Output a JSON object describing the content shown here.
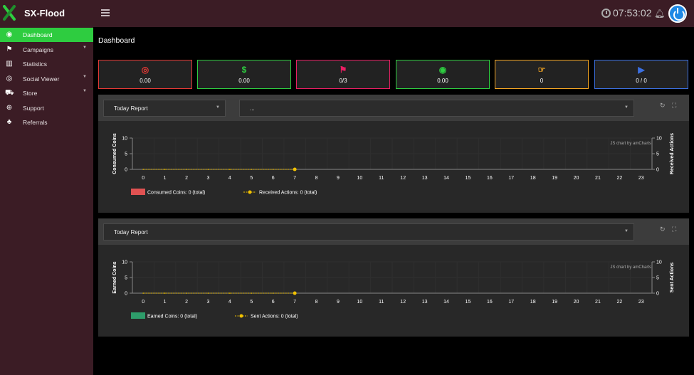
{
  "app": {
    "brand": "SX-Flood",
    "clock": "07:53:02"
  },
  "sidebar": {
    "items": [
      {
        "label": "Dashboard",
        "icon": "dashboard-icon",
        "glyph": "◉",
        "active": true,
        "caret": false
      },
      {
        "label": "Campaigns",
        "icon": "flag-icon",
        "glyph": "⚑",
        "active": false,
        "caret": true
      },
      {
        "label": "Statistics",
        "icon": "bar-chart-icon",
        "glyph": "▥",
        "active": false,
        "caret": false
      },
      {
        "label": "Social Viewer",
        "icon": "play-circle-icon",
        "glyph": "◎",
        "active": false,
        "caret": true
      },
      {
        "label": "Store",
        "icon": "cart-icon",
        "glyph": "⛟",
        "active": false,
        "caret": true
      },
      {
        "label": "Support",
        "icon": "lifebuoy-icon",
        "glyph": "⊕",
        "active": false,
        "caret": false
      },
      {
        "label": "Referrals",
        "icon": "sitemap-icon",
        "glyph": "♣",
        "active": false,
        "caret": false
      }
    ]
  },
  "page": {
    "title": "Dashboard"
  },
  "stats": [
    {
      "value": "0.00",
      "icon": "bullseye-icon",
      "glyph": "◎",
      "color": "#e53935"
    },
    {
      "value": "0.00",
      "icon": "dollar-icon",
      "glyph": "$",
      "color": "#2ecc40"
    },
    {
      "value": "0/3",
      "icon": "flag-checkered-icon",
      "glyph": "⚑",
      "color": "#e91e63"
    },
    {
      "value": "0.00",
      "icon": "dot-circle-icon",
      "glyph": "◉",
      "color": "#2ecc40"
    },
    {
      "value": "0",
      "icon": "hand-pointer-icon",
      "glyph": "☞",
      "color": "#f5a623"
    },
    {
      "value": "0 / 0",
      "icon": "play-icon",
      "glyph": "▶",
      "color": "#3b6fe0"
    }
  ],
  "panels": [
    {
      "report_select": "Today Report",
      "second_select": "...",
      "credit": "JS chart by amCharts",
      "legend": [
        {
          "label": "Consumed Coins: 0 (total)",
          "color": "#e05252"
        },
        {
          "label": "Received Actions: 0 (total)",
          "color": "#f2c200"
        }
      ],
      "chart_data": {
        "type": "bar",
        "categories": [
          "0",
          "1",
          "2",
          "3",
          "4",
          "5",
          "6",
          "7",
          "8",
          "9",
          "10",
          "11",
          "12",
          "13",
          "14",
          "15",
          "16",
          "17",
          "18",
          "19",
          "20",
          "21",
          "22",
          "23"
        ],
        "ylabel": "Consumed Coins",
        "y2label": "Received Actions",
        "ylim": [
          0,
          10
        ],
        "yticks": [
          0,
          5,
          10
        ],
        "series": [
          {
            "name": "Consumed Coins",
            "type": "bar",
            "values": [
              0,
              0,
              0,
              0,
              0,
              0,
              0,
              0,
              0,
              0,
              0,
              0,
              0,
              0,
              0,
              0,
              0,
              0,
              0,
              0,
              0,
              0,
              0,
              0
            ],
            "color": "#e05252"
          },
          {
            "name": "Received Actions",
            "type": "line",
            "values": [
              0,
              0,
              0,
              0,
              0,
              0,
              0,
              0
            ],
            "color": "#f2c200"
          }
        ]
      }
    },
    {
      "report_select": "Today Report",
      "credit": "JS chart by amCharts",
      "legend": [
        {
          "label": "Earned Coins: 0 (total)",
          "color": "#2e9c6a"
        },
        {
          "label": "Sent Actions: 0 (total)",
          "color": "#f2c200"
        }
      ],
      "chart_data": {
        "type": "bar",
        "categories": [
          "0",
          "1",
          "2",
          "3",
          "4",
          "5",
          "6",
          "7",
          "8",
          "9",
          "10",
          "11",
          "12",
          "13",
          "14",
          "15",
          "16",
          "17",
          "18",
          "19",
          "20",
          "21",
          "22",
          "23"
        ],
        "ylabel": "Earned Coins",
        "y2label": "Sent Actions",
        "ylim": [
          0,
          10
        ],
        "yticks": [
          0,
          5,
          10
        ],
        "series": [
          {
            "name": "Earned Coins",
            "type": "bar",
            "values": [
              0,
              0,
              0,
              0,
              0,
              0,
              0,
              0,
              0,
              0,
              0,
              0,
              0,
              0,
              0,
              0,
              0,
              0,
              0,
              0,
              0,
              0,
              0,
              0
            ],
            "color": "#2e9c6a"
          },
          {
            "name": "Sent Actions",
            "type": "line",
            "values": [
              0,
              0,
              0,
              0,
              0,
              0,
              0,
              0
            ],
            "color": "#f2c200"
          }
        ]
      }
    }
  ]
}
